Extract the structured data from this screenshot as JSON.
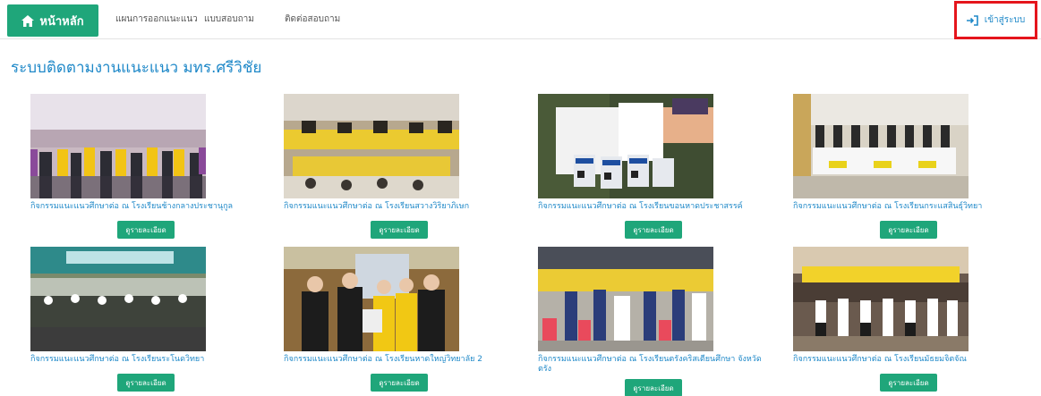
{
  "nav": {
    "home_label": "หน้าหลัก",
    "links": [
      "แผนการออกแนะแนว",
      "แบบสอบถาม",
      "ติดต่อสอบถาม"
    ],
    "login_label": "เข้าสู่ระบบ",
    "accent_color": "#1fa67a",
    "highlight_color": "#e5151c"
  },
  "page": {
    "title": "ระบบติดตามงานแนะแนว มทร.ศรีวิชัย"
  },
  "cards": [
    {
      "caption": "กิจกรรมแนะแนวศึกษาต่อ ณ โรงเรียนช้างกลางประชานุกูล",
      "button": "ดูรายละเอียด"
    },
    {
      "caption": "กิจกรรมแนะแนวศึกษาต่อ ณ โรงเรียนสวางวิริยาภิเษก",
      "button": "ดูรายละเอียด"
    },
    {
      "caption": "กิจกรรมแนะแนวศึกษาต่อ ณ โรงเรียนขอนหาดประชาสรรค์",
      "button": "ดูรายละเอียด"
    },
    {
      "caption": "กิจกรรมแนะแนวศึกษาต่อ ณ โรงเรียนกระแสสินธุ์วิทยา",
      "button": "ดูรายละเอียด"
    },
    {
      "caption": "กิจกรรมแนะแนวศึกษาต่อ ณ โรงเรียนระโนดวิทยา",
      "button": "ดูรายละเอียด"
    },
    {
      "caption": "กิจกรรมแนะแนวศึกษาต่อ ณ โรงเรียนหาดใหญ่วิทยาลัย 2",
      "button": "ดูรายละเอียด"
    },
    {
      "caption": "กิจกรรมแนะแนวศึกษาต่อ ณ โรงเรียนตรังคริสเตียนศึกษา จังหวัดตรัง",
      "button": "ดูรายละเอียด"
    },
    {
      "caption": "กิจกรรมแนะแนวศึกษาต่อ ณ โรงเรียนมัธยมจิตจัณ",
      "button": "ดูรายละเอียด"
    }
  ]
}
